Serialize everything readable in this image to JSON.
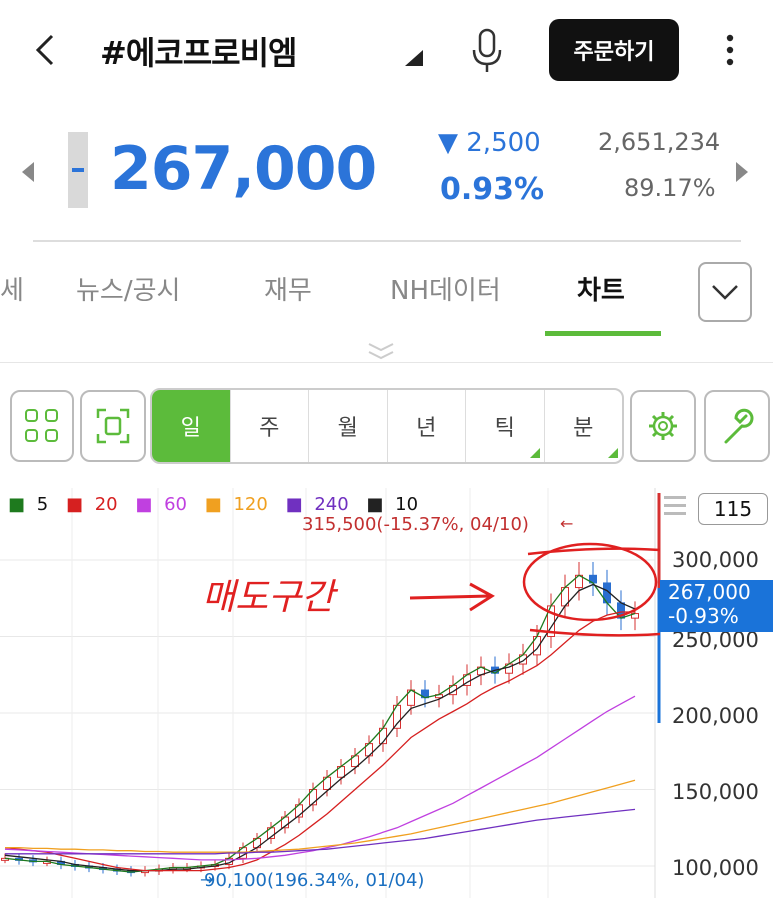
{
  "header": {
    "back_icon": "chevron-left-icon",
    "title": "#에코프로비엠",
    "order_label": "주문하기",
    "mic_icon": "microphone-icon",
    "more_icon": "more-vertical-icon"
  },
  "quote": {
    "price": "267,000",
    "change": "2,500",
    "change_percent": "0.93%",
    "volume": "2,651,234",
    "ratio": "89.17%",
    "down_color": "#2b74d9"
  },
  "tabs": {
    "items": [
      "세",
      "뉴스/공시",
      "재무",
      "NH데이터",
      "차트"
    ],
    "active_index": 4
  },
  "toolbar": {
    "periods": [
      "일",
      "주",
      "월",
      "년",
      "틱",
      "분"
    ],
    "selected": "일",
    "accent": "#5cbb3b"
  },
  "chart_data": {
    "type": "line",
    "legend": [
      {
        "label": "5",
        "color": "#1e7a1e"
      },
      {
        "label": "20",
        "color": "#d62020"
      },
      {
        "label": "60",
        "color": "#c040e0"
      },
      {
        "label": "120",
        "color": "#f0a020"
      },
      {
        "label": "240",
        "color": "#7030c0"
      },
      {
        "label": "10",
        "color": "#222222"
      }
    ],
    "count": "115",
    "y_ticks": [
      "300,000",
      "250,000",
      "200,000",
      "150,000",
      "100,000"
    ],
    "ylim": [
      85000,
      325000
    ],
    "annotations": {
      "high": "315,500(-15.37%, 04/10)",
      "low": "90,100(196.34%, 01/04)",
      "handwritten": "매도구간"
    },
    "current": {
      "price": "267,000",
      "change": "-0.93%"
    },
    "series": [
      {
        "name": "5",
        "values": [
          105000,
          104000,
          103000,
          103000,
          101000,
          100000,
          99000,
          98000,
          97000,
          96000,
          97000,
          98000,
          99000,
          99000,
          100000,
          101000,
          105000,
          112000,
          118000,
          125000,
          132000,
          140000,
          150000,
          158000,
          165000,
          172000,
          180000,
          190000,
          205000,
          215000,
          210000,
          212000,
          218000,
          225000,
          230000,
          226000,
          232000,
          238000,
          250000,
          270000,
          282000,
          290000,
          285000,
          272000,
          262000,
          265000
        ]
      },
      {
        "name": "10",
        "values": [
          107000,
          106000,
          105000,
          104000,
          103000,
          101000,
          100000,
          99000,
          98000,
          97000,
          97000,
          97000,
          98000,
          98000,
          99000,
          100000,
          102000,
          107000,
          112000,
          119000,
          126000,
          133000,
          141000,
          149000,
          157000,
          164000,
          172000,
          181000,
          193000,
          203000,
          206000,
          209000,
          214000,
          220000,
          225000,
          228000,
          230000,
          234000,
          242000,
          256000,
          270000,
          280000,
          284000,
          280000,
          272000,
          268000
        ]
      },
      {
        "name": "20",
        "values": [
          112000,
          111000,
          110000,
          109000,
          107000,
          105000,
          103000,
          101000,
          99000,
          98000,
          97000,
          97000,
          97000,
          97000,
          97000,
          98000,
          99000,
          101000,
          104000,
          109000,
          114000,
          120000,
          127000,
          134000,
          142000,
          150000,
          158000,
          166000,
          175000,
          184000,
          190000,
          196000,
          201000,
          206000,
          212000,
          217000,
          221000,
          226000,
          231000,
          238000,
          246000,
          254000,
          260000,
          264000,
          266000,
          266000
        ]
      },
      {
        "name": "60",
        "values": [
          111000,
          110500,
          110000,
          109500,
          109000,
          108500,
          108000,
          107500,
          107000,
          106500,
          106000,
          105500,
          105000,
          104500,
          104000,
          104000,
          104000,
          104500,
          105000,
          106000,
          107000,
          108500,
          110000,
          112000,
          114000,
          116500,
          119000,
          122000,
          125000,
          129000,
          133000,
          137000,
          141000,
          146000,
          151000,
          156000,
          161000,
          166000,
          171000,
          177000,
          183000,
          189000,
          195000,
          201000,
          206000,
          211000
        ]
      },
      {
        "name": "120",
        "values": [
          112000,
          112000,
          111500,
          111500,
          111000,
          111000,
          110500,
          110500,
          110000,
          110000,
          109500,
          109500,
          109000,
          109000,
          109000,
          109000,
          109000,
          109000,
          109500,
          110000,
          110500,
          111000,
          112000,
          113000,
          114000,
          115000,
          116500,
          118000,
          119500,
          121000,
          123000,
          125000,
          127000,
          129000,
          131000,
          133000,
          135000,
          137000,
          139000,
          141000,
          143500,
          146000,
          148500,
          151000,
          153500,
          156000
        ]
      },
      {
        "name": "240",
        "values": [
          108000,
          108000,
          108000,
          108000,
          108000,
          108000,
          108000,
          108000,
          108000,
          108000,
          108000,
          108000,
          108000,
          108000,
          108000,
          108000,
          108500,
          108500,
          109000,
          109000,
          109500,
          110000,
          110500,
          111000,
          112000,
          113000,
          114000,
          115000,
          116000,
          117000,
          118000,
          119500,
          121000,
          122500,
          124000,
          125500,
          127000,
          128500,
          130000,
          131000,
          132000,
          133000,
          134000,
          135000,
          136000,
          137000
        ]
      }
    ]
  }
}
